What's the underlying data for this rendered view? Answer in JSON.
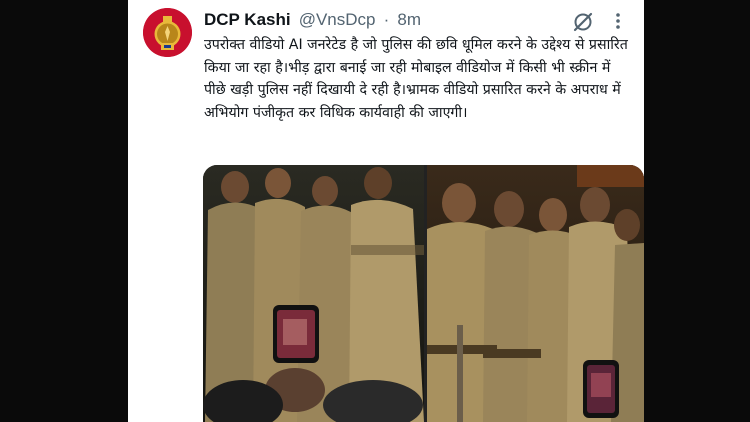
{
  "tweet": {
    "author_name": "DCP Kashi",
    "handle": "@VnsDcp",
    "separator": "·",
    "time": "8m",
    "avatar_icon": "police-emblem-icon",
    "grok_icon": "grok-icon",
    "more_icon": "more-options-icon",
    "text": "उपरोक्त वीडियो AI जनरेटेड है जो पुलिस की छवि धूमिल करने के उद्देश्य से प्रसारित किया जा रहा है।भीड़ द्वारा बनाई जा रही मोबाइल वीडियोज में किसी भी स्क्रीन में पीछे खड़ी पुलिस नहीं दिखायी दे रही है।भ्रामक वीडियो प्रसारित करने के अपराध में अभियोग पंजीकृत कर विधिक कार्यवाही की जाएगी।"
  },
  "colors": {
    "name": "#0f1419",
    "secondary": "#536471",
    "avatar_bg": "#c8102e",
    "background": "#0a0a0a",
    "card": "#ffffff"
  }
}
